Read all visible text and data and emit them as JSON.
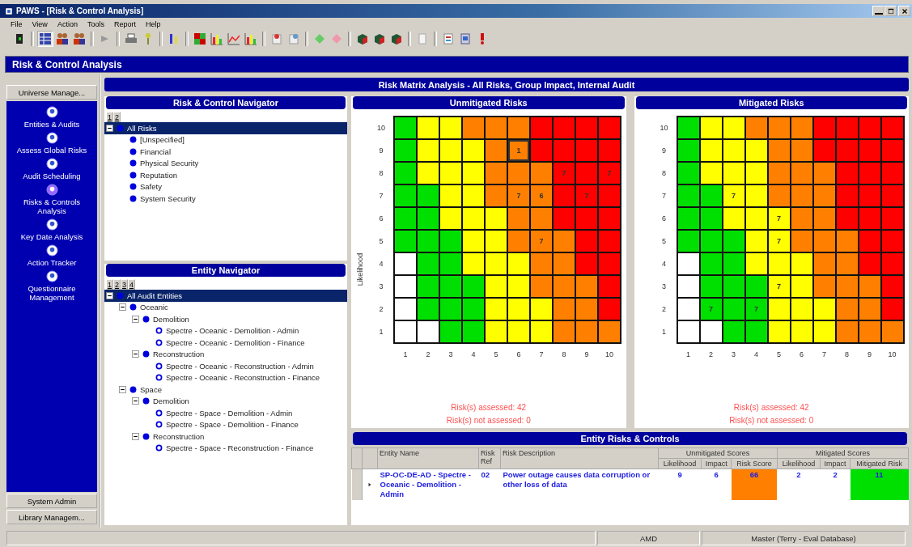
{
  "window": {
    "title": "PAWS - [Risk & Control Analysis]"
  },
  "menu": [
    "File",
    "View",
    "Action",
    "Tools",
    "Report",
    "Help"
  ],
  "module_title": "Risk & Control Analysis",
  "sidebar": {
    "top_buttons": [
      "Universe Manage..."
    ],
    "items": [
      {
        "label": "Entities & Audits",
        "selected": false
      },
      {
        "label": "Assess Global Risks",
        "selected": false
      },
      {
        "label": "Audit Scheduling",
        "selected": false
      },
      {
        "label": "Risks & Controls Analysis",
        "selected": true
      },
      {
        "label": "Key Date Analysis",
        "selected": false
      },
      {
        "label": "Action Tracker",
        "selected": false
      },
      {
        "label": "Questionnaire Management",
        "selected": false
      }
    ],
    "bottom_buttons": [
      "System Admin",
      "Library Managem..."
    ]
  },
  "analysis_title": "Risk Matrix Analysis - All Risks, Group Impact, Internal Audit",
  "risk_navigator": {
    "title": "Risk & Control Navigator",
    "levels": [
      "1",
      "2"
    ],
    "tree": [
      {
        "label": "All Risks",
        "kind": "node",
        "selected": true,
        "expanded": true,
        "children": [
          {
            "label": "[Unspecified]",
            "kind": "node",
            "selected": false
          },
          {
            "label": "Financial",
            "kind": "node",
            "selected": false
          },
          {
            "label": "Physical Security",
            "kind": "node",
            "selected": false
          },
          {
            "label": "Reputation",
            "kind": "node",
            "selected": false
          },
          {
            "label": "Safety",
            "kind": "node",
            "selected": false
          },
          {
            "label": "System Security",
            "kind": "node",
            "selected": false
          }
        ]
      }
    ]
  },
  "entity_navigator": {
    "title": "Entity Navigator",
    "levels": [
      "1",
      "2",
      "3",
      "4"
    ],
    "tree": [
      {
        "label": "All Audit Entities",
        "kind": "node",
        "selected": true,
        "expanded": true,
        "children": [
          {
            "label": "Oceanic",
            "kind": "node",
            "selected": false,
            "expanded": true,
            "children": [
              {
                "label": "Demolition",
                "kind": "node",
                "selected": false,
                "expanded": true,
                "children": [
                  {
                    "label": "Spectre - Oceanic - Demolition - Admin",
                    "kind": "entity",
                    "selected": false
                  },
                  {
                    "label": "Spectre - Oceanic - Demolition - Finance",
                    "kind": "entity",
                    "selected": false
                  }
                ]
              },
              {
                "label": "Reconstruction",
                "kind": "node",
                "selected": false,
                "expanded": true,
                "children": [
                  {
                    "label": "Spectre - Oceanic - Reconstruction - Admin",
                    "kind": "entity",
                    "selected": false
                  },
                  {
                    "label": "Spectre - Oceanic - Reconstruction - Finance",
                    "kind": "entity",
                    "selected": false
                  }
                ]
              }
            ]
          },
          {
            "label": "Space",
            "kind": "node",
            "selected": false,
            "expanded": true,
            "children": [
              {
                "label": "Demolition",
                "kind": "node",
                "selected": false,
                "expanded": true,
                "children": [
                  {
                    "label": "Spectre - Space - Demolition - Admin",
                    "kind": "entity",
                    "selected": false
                  },
                  {
                    "label": "Spectre - Space - Demolition - Finance",
                    "kind": "entity",
                    "selected": false
                  }
                ]
              },
              {
                "label": "Reconstruction",
                "kind": "node",
                "selected": false,
                "expanded": true,
                "children": [
                  {
                    "label": "Spectre - Space - Reconstruction - Finance",
                    "kind": "entity",
                    "selected": false
                  }
                ]
              }
            ]
          }
        ]
      }
    ]
  },
  "matrices": [
    {
      "title": "Unmitigated Risks",
      "ylabel": "Likelihood",
      "xticks": [
        "1",
        "2",
        "3",
        "4",
        "5",
        "6",
        "7",
        "8",
        "9",
        "10"
      ],
      "rows": [
        {
          "label": "10",
          "cells": [
            {
              "color": "#00e000"
            },
            {
              "color": "#ffff00"
            },
            {
              "color": "#ffff00"
            },
            {
              "color": "#ff8000"
            },
            {
              "color": "#ff8000"
            },
            {
              "color": "#ff8000"
            },
            {
              "color": "#ff0000"
            },
            {
              "color": "#ff0000"
            },
            {
              "color": "#ff0000"
            },
            {
              "color": "#ff0000"
            }
          ]
        },
        {
          "label": "9",
          "cells": [
            {
              "color": "#00e000"
            },
            {
              "color": "#ffff00"
            },
            {
              "color": "#ffff00"
            },
            {
              "color": "#ffff00"
            },
            {
              "color": "#ff8000"
            },
            {
              "color": "#ff8000",
              "count": "1",
              "selected": true
            },
            {
              "color": "#ff0000"
            },
            {
              "color": "#ff0000"
            },
            {
              "color": "#ff0000"
            },
            {
              "color": "#ff0000"
            }
          ]
        },
        {
          "label": "8",
          "cells": [
            {
              "color": "#00e000"
            },
            {
              "color": "#ffff00"
            },
            {
              "color": "#ffff00"
            },
            {
              "color": "#ffff00"
            },
            {
              "color": "#ff8000"
            },
            {
              "color": "#ff8000"
            },
            {
              "color": "#ff8000"
            },
            {
              "color": "#ff0000",
              "count": "7",
              "selected": false
            },
            {
              "color": "#ff0000"
            },
            {
              "color": "#ff0000",
              "count": "7",
              "selected": false
            }
          ]
        },
        {
          "label": "7",
          "cells": [
            {
              "color": "#00e000"
            },
            {
              "color": "#00e000"
            },
            {
              "color": "#ffff00"
            },
            {
              "color": "#ffff00"
            },
            {
              "color": "#ff8000"
            },
            {
              "color": "#ff8000",
              "count": "7",
              "selected": false
            },
            {
              "color": "#ff8000",
              "count": "6",
              "selected": false
            },
            {
              "color": "#ff0000"
            },
            {
              "color": "#ff0000",
              "count": "7",
              "selected": false
            },
            {
              "color": "#ff0000"
            }
          ]
        },
        {
          "label": "6",
          "cells": [
            {
              "color": "#00e000"
            },
            {
              "color": "#00e000"
            },
            {
              "color": "#ffff00"
            },
            {
              "color": "#ffff00"
            },
            {
              "color": "#ffff00"
            },
            {
              "color": "#ff8000"
            },
            {
              "color": "#ff8000"
            },
            {
              "color": "#ff0000"
            },
            {
              "color": "#ff0000"
            },
            {
              "color": "#ff0000"
            }
          ]
        },
        {
          "label": "5",
          "cells": [
            {
              "color": "#00e000"
            },
            {
              "color": "#00e000"
            },
            {
              "color": "#00e000"
            },
            {
              "color": "#ffff00"
            },
            {
              "color": "#ffff00"
            },
            {
              "color": "#ff8000"
            },
            {
              "color": "#ff8000",
              "count": "7",
              "selected": false
            },
            {
              "color": "#ff8000"
            },
            {
              "color": "#ff0000"
            },
            {
              "color": "#ff0000"
            }
          ]
        },
        {
          "label": "4",
          "cells": [
            {
              "color": "#ffffff"
            },
            {
              "color": "#00e000"
            },
            {
              "color": "#00e000"
            },
            {
              "color": "#ffff00"
            },
            {
              "color": "#ffff00"
            },
            {
              "color": "#ffff00"
            },
            {
              "color": "#ff8000"
            },
            {
              "color": "#ff8000"
            },
            {
              "color": "#ff0000"
            },
            {
              "color": "#ff0000"
            }
          ]
        },
        {
          "label": "3",
          "cells": [
            {
              "color": "#ffffff"
            },
            {
              "color": "#00e000"
            },
            {
              "color": "#00e000"
            },
            {
              "color": "#00e000"
            },
            {
              "color": "#ffff00"
            },
            {
              "color": "#ffff00"
            },
            {
              "color": "#ff8000"
            },
            {
              "color": "#ff8000"
            },
            {
              "color": "#ff8000"
            },
            {
              "color": "#ff0000"
            }
          ]
        },
        {
          "label": "2",
          "cells": [
            {
              "color": "#ffffff"
            },
            {
              "color": "#00e000"
            },
            {
              "color": "#00e000"
            },
            {
              "color": "#00e000"
            },
            {
              "color": "#ffff00"
            },
            {
              "color": "#ffff00"
            },
            {
              "color": "#ffff00"
            },
            {
              "color": "#ff8000"
            },
            {
              "color": "#ff8000"
            },
            {
              "color": "#ff0000"
            }
          ]
        },
        {
          "label": "1",
          "cells": [
            {
              "color": "#ffffff"
            },
            {
              "color": "#ffffff"
            },
            {
              "color": "#00e000"
            },
            {
              "color": "#00e000"
            },
            {
              "color": "#ffff00"
            },
            {
              "color": "#ffff00"
            },
            {
              "color": "#ffff00"
            },
            {
              "color": "#ff8000"
            },
            {
              "color": "#ff8000"
            },
            {
              "color": "#ff8000"
            }
          ]
        }
      ],
      "assessed": "Risk(s) assessed: 42",
      "not_assessed": "Risk(s) not assessed: 0"
    },
    {
      "title": "Mitigated Risks",
      "xticks": [
        "1",
        "2",
        "3",
        "4",
        "5",
        "6",
        "7",
        "8",
        "9",
        "10"
      ],
      "rows": [
        {
          "label": "10",
          "cells": [
            {
              "color": "#00e000"
            },
            {
              "color": "#ffff00"
            },
            {
              "color": "#ffff00"
            },
            {
              "color": "#ff8000"
            },
            {
              "color": "#ff8000"
            },
            {
              "color": "#ff8000"
            },
            {
              "color": "#ff0000"
            },
            {
              "color": "#ff0000"
            },
            {
              "color": "#ff0000"
            },
            {
              "color": "#ff0000"
            }
          ]
        },
        {
          "label": "9",
          "cells": [
            {
              "color": "#00e000"
            },
            {
              "color": "#ffff00"
            },
            {
              "color": "#ffff00"
            },
            {
              "color": "#ffff00"
            },
            {
              "color": "#ff8000"
            },
            {
              "color": "#ff8000"
            },
            {
              "color": "#ff0000"
            },
            {
              "color": "#ff0000"
            },
            {
              "color": "#ff0000"
            },
            {
              "color": "#ff0000"
            }
          ]
        },
        {
          "label": "8",
          "cells": [
            {
              "color": "#00e000"
            },
            {
              "color": "#ffff00"
            },
            {
              "color": "#ffff00"
            },
            {
              "color": "#ffff00"
            },
            {
              "color": "#ff8000"
            },
            {
              "color": "#ff8000"
            },
            {
              "color": "#ff8000"
            },
            {
              "color": "#ff0000"
            },
            {
              "color": "#ff0000"
            },
            {
              "color": "#ff0000"
            }
          ]
        },
        {
          "label": "7",
          "cells": [
            {
              "color": "#00e000"
            },
            {
              "color": "#00e000"
            },
            {
              "color": "#ffff00",
              "count": "7",
              "selected": false
            },
            {
              "color": "#ffff00"
            },
            {
              "color": "#ff8000"
            },
            {
              "color": "#ff8000"
            },
            {
              "color": "#ff8000"
            },
            {
              "color": "#ff0000"
            },
            {
              "color": "#ff0000"
            },
            {
              "color": "#ff0000"
            }
          ]
        },
        {
          "label": "6",
          "cells": [
            {
              "color": "#00e000"
            },
            {
              "color": "#00e000"
            },
            {
              "color": "#ffff00"
            },
            {
              "color": "#ffff00"
            },
            {
              "color": "#ffff00",
              "count": "7",
              "selected": false
            },
            {
              "color": "#ff8000"
            },
            {
              "color": "#ff8000"
            },
            {
              "color": "#ff0000"
            },
            {
              "color": "#ff0000"
            },
            {
              "color": "#ff0000"
            }
          ]
        },
        {
          "label": "5",
          "cells": [
            {
              "color": "#00e000"
            },
            {
              "color": "#00e000"
            },
            {
              "color": "#00e000"
            },
            {
              "color": "#ffff00"
            },
            {
              "color": "#ffff00",
              "count": "7",
              "selected": false
            },
            {
              "color": "#ff8000"
            },
            {
              "color": "#ff8000"
            },
            {
              "color": "#ff8000"
            },
            {
              "color": "#ff0000"
            },
            {
              "color": "#ff0000"
            }
          ]
        },
        {
          "label": "4",
          "cells": [
            {
              "color": "#ffffff"
            },
            {
              "color": "#00e000"
            },
            {
              "color": "#00e000"
            },
            {
              "color": "#ffff00"
            },
            {
              "color": "#ffff00"
            },
            {
              "color": "#ffff00"
            },
            {
              "color": "#ff8000"
            },
            {
              "color": "#ff8000"
            },
            {
              "color": "#ff0000"
            },
            {
              "color": "#ff0000"
            }
          ]
        },
        {
          "label": "3",
          "cells": [
            {
              "color": "#ffffff"
            },
            {
              "color": "#00e000"
            },
            {
              "color": "#00e000"
            },
            {
              "color": "#00e000"
            },
            {
              "color": "#ffff00",
              "count": "7",
              "selected": false
            },
            {
              "color": "#ffff00"
            },
            {
              "color": "#ff8000"
            },
            {
              "color": "#ff8000"
            },
            {
              "color": "#ff8000"
            },
            {
              "color": "#ff0000"
            }
          ]
        },
        {
          "label": "2",
          "cells": [
            {
              "color": "#ffffff"
            },
            {
              "color": "#00e000",
              "count": "7",
              "selected": false
            },
            {
              "color": "#00e000"
            },
            {
              "color": "#00e000",
              "count": "7",
              "selected": false
            },
            {
              "color": "#ffff00"
            },
            {
              "color": "#ffff00"
            },
            {
              "color": "#ffff00"
            },
            {
              "color": "#ff8000"
            },
            {
              "color": "#ff8000"
            },
            {
              "color": "#ff0000"
            }
          ]
        },
        {
          "label": "1",
          "cells": [
            {
              "color": "#ffffff"
            },
            {
              "color": "#ffffff"
            },
            {
              "color": "#00e000"
            },
            {
              "color": "#00e000"
            },
            {
              "color": "#ffff00"
            },
            {
              "color": "#ffff00"
            },
            {
              "color": "#ffff00"
            },
            {
              "color": "#ff8000"
            },
            {
              "color": "#ff8000"
            },
            {
              "color": "#ff8000"
            }
          ]
        }
      ],
      "assessed": "Risk(s) assessed: 42",
      "not_assessed": "Risk(s) not assessed: 0"
    }
  ],
  "entity_table": {
    "title": "Entity Risks & Controls",
    "columns": [
      "Entity Name",
      "Risk Ref",
      "Risk Description"
    ],
    "column_groups": [
      {
        "label": "Unmitigated Scores",
        "columns": [
          "Likelihood",
          "Impact",
          "Risk Score"
        ]
      },
      {
        "label": "Mitigated Scores",
        "columns": [
          "Likelihood",
          "Impact",
          "Mitigated Risk"
        ]
      }
    ],
    "rows": [
      {
        "current": true,
        "entity_name": "SP-OC-DE-AD - Spectre - Oceanic - Demolition - Admin",
        "risk_ref": "02",
        "description": "Power outage causes data corruption or other loss of data",
        "unmitigated": {
          "likelihood": "9",
          "impact": "6",
          "score": "66",
          "color": "#ff8000"
        },
        "mitigated": {
          "likelihood": "2",
          "impact": "2",
          "score": "11",
          "color": "#00e000"
        }
      }
    ]
  },
  "status_bar": [
    "AMD",
    "Master (Terry - Eval Database)"
  ]
}
